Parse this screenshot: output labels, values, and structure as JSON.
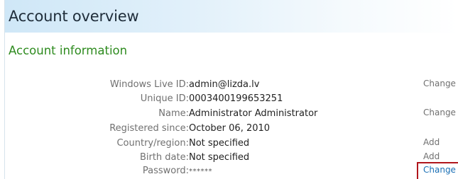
{
  "page": {
    "title": "Account overview"
  },
  "section": {
    "title": "Account information"
  },
  "rows": [
    {
      "label": "Windows Live ID:",
      "value": "admin@lizda.lv",
      "action": "Change"
    },
    {
      "label": "Unique ID:",
      "value": "0003400199653251",
      "action": ""
    },
    {
      "label": "Name:",
      "value": "Administrator Administrator",
      "action": "Change"
    },
    {
      "label": "Registered since:",
      "value": "October 06, 2010",
      "action": ""
    },
    {
      "label": "Country/region:",
      "value": "Not specified",
      "action": "Add"
    },
    {
      "label": "Birth date:",
      "value": "Not specified",
      "action": "Add"
    },
    {
      "label": "Password:",
      "value": "******",
      "action": "Change"
    }
  ],
  "colors": {
    "section_title": "#2e8b1f",
    "link": "#1a6fb5",
    "highlight": "#b0161c"
  }
}
